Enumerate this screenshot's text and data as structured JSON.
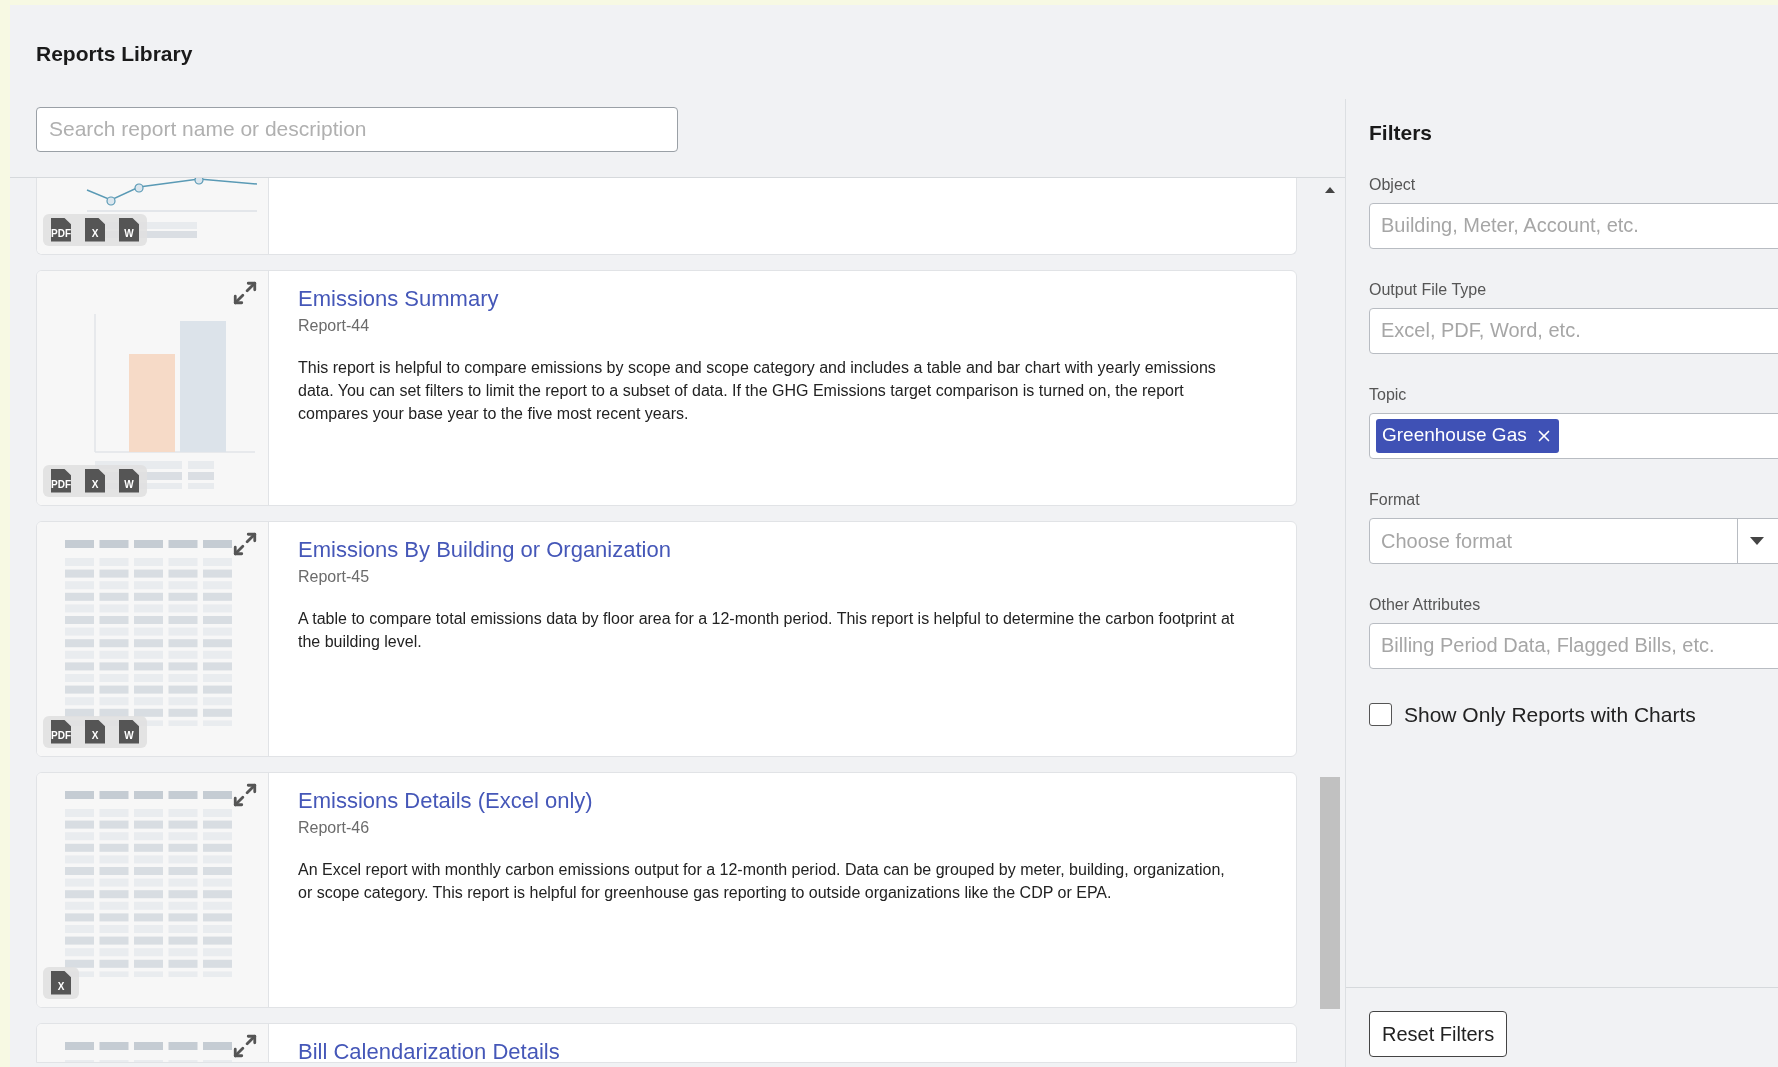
{
  "page": {
    "title": "Reports Library"
  },
  "search": {
    "placeholder": "Search report name or description"
  },
  "reports": [
    {
      "kind": "line",
      "partial": true,
      "file_types": [
        "PDF",
        "X",
        "W"
      ]
    },
    {
      "kind": "bar",
      "partial": false,
      "title": "Emissions Summary",
      "id": "Report-44",
      "description": "This report is helpful to compare emissions by scope and scope category and includes a table and bar chart with yearly emissions data. You can set filters to limit the report to a subset of data. If the GHG Emissions target comparison is turned on, the report compares your base year to the five most recent years.",
      "file_types": [
        "PDF",
        "X",
        "W"
      ]
    },
    {
      "kind": "table",
      "partial": false,
      "title": "Emissions By Building or Organization",
      "id": "Report-45",
      "description": "A table to compare total emissions data by floor area for a 12-month period. This report is helpful to determine the carbon footprint at the building level.",
      "file_types": [
        "PDF",
        "X",
        "W"
      ]
    },
    {
      "kind": "table",
      "partial": false,
      "title": "Emissions Details (Excel only)",
      "id": "Report-46",
      "description": "An Excel report with monthly carbon emissions output for a 12-month period. Data can be grouped by meter, building, organization, or scope category. This report is helpful for greenhouse gas reporting to outside organizations like the CDP or EPA.",
      "file_types": [
        "X"
      ]
    },
    {
      "kind": "table",
      "partial": true,
      "title": "Bill Calendarization Details"
    }
  ],
  "filters": {
    "title": "Filters",
    "fields": [
      {
        "kind": "text",
        "label": "Object",
        "placeholder": "Building, Meter, Account, etc."
      },
      {
        "kind": "text",
        "label": "Output File Type",
        "placeholder": "Excel, PDF, Word, etc."
      },
      {
        "kind": "tags",
        "label": "Topic",
        "tags": [
          "Greenhouse Gas"
        ]
      },
      {
        "kind": "select",
        "label": "Format",
        "placeholder": "Choose format"
      },
      {
        "kind": "text",
        "label": "Other Attributes",
        "placeholder": "Billing Period Data, Flagged Bills, etc."
      }
    ],
    "show_only_charts": {
      "label": "Show Only Reports with Charts",
      "checked": false
    },
    "reset_button": "Reset Filters"
  }
}
